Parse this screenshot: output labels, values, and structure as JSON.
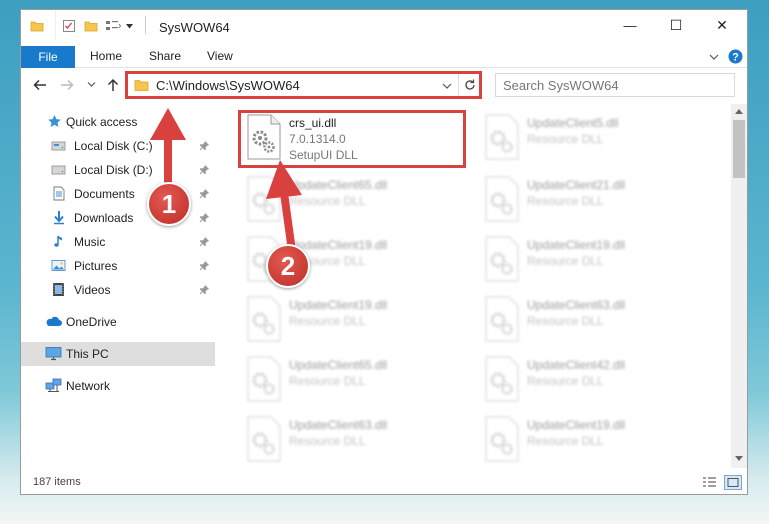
{
  "window": {
    "title": "SysWOW64",
    "minimize_glyph": "—",
    "maximize_glyph": "☐",
    "close_glyph": "✕"
  },
  "ribbon": {
    "tabs": [
      "File",
      "Home",
      "Share",
      "View"
    ]
  },
  "address": {
    "path": "C:\\Windows\\SysWOW64"
  },
  "search": {
    "placeholder": "Search SysWOW64"
  },
  "sidebar": {
    "items": [
      {
        "label": "Quick access",
        "icon": "star-icon",
        "pinned": false
      },
      {
        "label": "Local Disk (C:)",
        "icon": "drive-icon",
        "pinned": true
      },
      {
        "label": "Local Disk (D:)",
        "icon": "drive-icon",
        "pinned": true
      },
      {
        "label": "Documents",
        "icon": "documents-icon",
        "pinned": true
      },
      {
        "label": "Downloads",
        "icon": "download-icon",
        "pinned": true
      },
      {
        "label": "Music",
        "icon": "music-icon",
        "pinned": true
      },
      {
        "label": "Pictures",
        "icon": "pictures-icon",
        "pinned": true
      },
      {
        "label": "Videos",
        "icon": "videos-icon",
        "pinned": true
      },
      {
        "label": "OneDrive",
        "icon": "cloud-icon",
        "pinned": false
      },
      {
        "label": "This PC",
        "icon": "monitor-icon",
        "pinned": false,
        "selected": true
      },
      {
        "label": "Network",
        "icon": "network-icon",
        "pinned": false
      }
    ]
  },
  "files": [
    {
      "name": "crs_ui.dll",
      "version": "7.0.1314.0",
      "type": "SetupUI DLL",
      "highlighted": true
    },
    {
      "name": "UpdateClient5.dll",
      "type": "Resource DLL"
    },
    {
      "name": "UpdateClient65.dll",
      "type": "Resource DLL"
    },
    {
      "name": "UpdateClient21.dll",
      "type": "Resource DLL"
    },
    {
      "name": "UpdateClient19.dll",
      "type": "Resource DLL"
    },
    {
      "name": "UpdateClient19.dll",
      "type": "Resource DLL"
    },
    {
      "name": "UpdateClient19.dll",
      "type": "Resource DLL"
    },
    {
      "name": "UpdateClient63.dll",
      "type": "Resource DLL"
    },
    {
      "name": "UpdateClient65.dll",
      "type": "Resource DLL"
    },
    {
      "name": "UpdateClient42.dll",
      "type": "Resource DLL"
    },
    {
      "name": "UpdateClient63.dll",
      "type": "Resource DLL"
    },
    {
      "name": "UpdateClient19.dll",
      "type": "Resource DLL"
    }
  ],
  "status": {
    "item_count": "187 items"
  },
  "annotations": {
    "step1": "1",
    "step2": "2",
    "color": "#d9413f"
  },
  "colors": {
    "file_tab": "#1979ca",
    "selected_bg": "#dedede",
    "callout": "#d9413f"
  }
}
